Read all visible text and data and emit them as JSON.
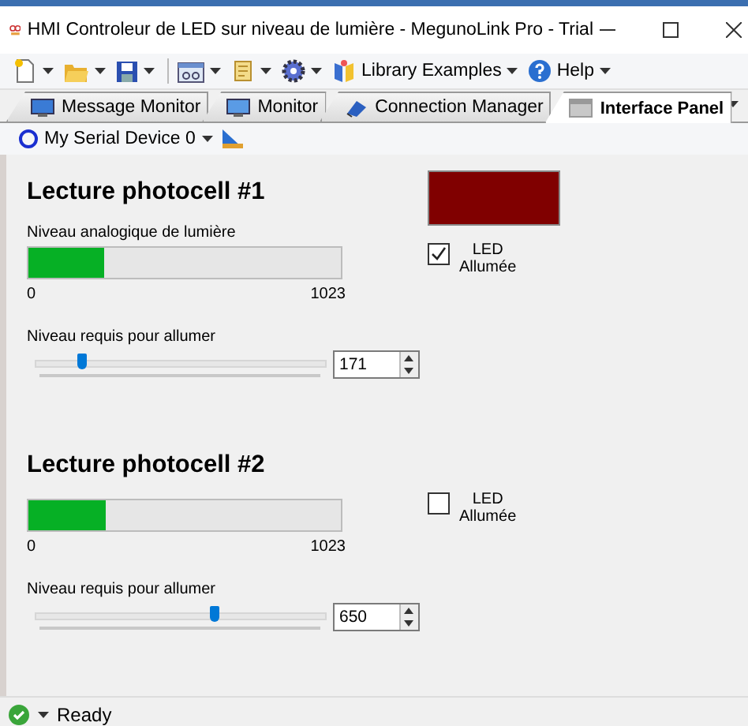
{
  "window": {
    "title": "HMI Controleur de LED sur niveau de lumière - MegunoLink Pro - Trial"
  },
  "toolbar": {
    "items": [
      {
        "kind": "new"
      },
      {
        "kind": "open"
      },
      {
        "kind": "save"
      },
      {
        "kind": "view"
      },
      {
        "kind": "script"
      },
      {
        "kind": "settings"
      },
      {
        "kind": "library",
        "label": "Library Examples"
      },
      {
        "kind": "help",
        "label": "Help"
      }
    ]
  },
  "tabs": [
    {
      "label": "Message Monitor",
      "kind": "message",
      "selected": false
    },
    {
      "label": "Monitor",
      "kind": "monitor",
      "selected": false
    },
    {
      "label": "Connection Manager",
      "kind": "connection",
      "selected": false
    },
    {
      "label": "Interface Panel",
      "kind": "panel",
      "selected": true
    }
  ],
  "device_bar": {
    "device": "My Serial Device 0"
  },
  "sections": [
    {
      "title": "Lecture photocell #1",
      "level_label": "Niveau analogique de lumière",
      "level": 0.24,
      "min": "0",
      "max": "1023",
      "slider_label": "Niveau requis pour allumer",
      "slider": {
        "level": 0.167
      },
      "value": "171",
      "indicator": {
        "color": "#800000"
      },
      "led_checked": true,
      "led_label": "LED",
      "led_sublabel": "Allumée"
    },
    {
      "title": "Lecture photocell #2",
      "level": 0.245,
      "min": "0",
      "max": "1023",
      "slider_label": "Niveau requis pour allumer",
      "slider": {
        "level": 0.635
      },
      "value": "650",
      "led_checked": false,
      "led_label": "LED",
      "led_sublabel": "Allumée"
    }
  ],
  "status_bar": {
    "text": "Ready"
  }
}
